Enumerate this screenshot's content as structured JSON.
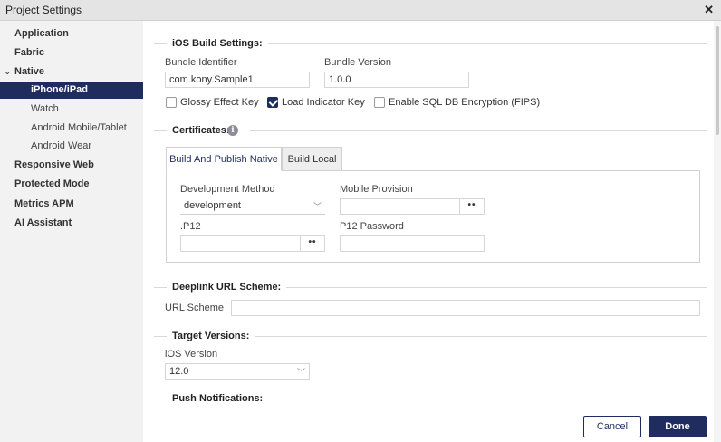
{
  "window": {
    "title": "Project Settings",
    "close_glyph": "✕"
  },
  "sidebar": {
    "items": [
      {
        "label": "Application"
      },
      {
        "label": "Fabric"
      },
      {
        "label": "Native",
        "expanded": true
      },
      {
        "label": "iPhone/iPad",
        "selected": true
      },
      {
        "label": "Watch"
      },
      {
        "label": "Android Mobile/Tablet"
      },
      {
        "label": "Android Wear"
      },
      {
        "label": "Responsive Web"
      },
      {
        "label": "Protected Mode"
      },
      {
        "label": "Metrics APM"
      },
      {
        "label": "AI Assistant"
      }
    ]
  },
  "ios_build": {
    "title": "iOS Build Settings:",
    "bundle_identifier_label": "Bundle Identifier",
    "bundle_identifier_value": "com.kony.Sample1",
    "bundle_version_label": "Bundle Version",
    "bundle_version_value": "1.0.0",
    "glossy_label": "Glossy Effect Key",
    "glossy_checked": false,
    "load_indicator_label": "Load Indicator Key",
    "load_indicator_checked": true,
    "sql_label": "Enable SQL DB Encryption (FIPS)",
    "sql_checked": false
  },
  "certificates": {
    "title": "Certificates:",
    "tabs": [
      {
        "label": "Build And Publish Native",
        "active": true
      },
      {
        "label": "Build Local",
        "active": false
      }
    ],
    "dev_method_label": "Development Method",
    "dev_method_value": "development",
    "mobile_provision_label": "Mobile Provision",
    "mobile_provision_value": "",
    "p12_label": ".P12",
    "p12_value": "",
    "p12_password_label": "P12 Password",
    "p12_password_value": "",
    "browse_glyph": "••"
  },
  "deeplink": {
    "title": "Deeplink URL Scheme:",
    "url_scheme_label": "URL Scheme",
    "url_scheme_value": ""
  },
  "target_versions": {
    "title": "Target Versions:",
    "ios_version_label": "iOS Version",
    "ios_version_value": "12.0"
  },
  "push": {
    "title": "Push Notifications:"
  },
  "footer": {
    "cancel_label": "Cancel",
    "done_label": "Done"
  },
  "colors": {
    "accent": "#1f2c5e",
    "sidebar_bg": "#f2f2f2",
    "titlebar_bg": "#e4e4e4"
  }
}
